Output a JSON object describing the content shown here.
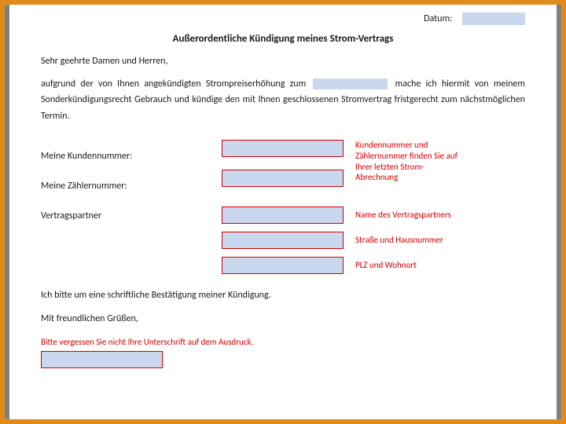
{
  "date_label": "Datum:",
  "title": "Außerordentliche Kündigung meines Strom-Vertrags",
  "salutation": "Sehr geehrte Damen und Herren,",
  "body_pre": "aufgrund der von Ihnen angekündigten Strompreiserhöhung zum ",
  "body_post": " mache ich hiermit von meinem Sonderkündigungsrecht Gebrauch und kündige den mit Ihnen geschlossenen Stromvertrag fristgerecht zum nächstmöglichen Termin.",
  "labels": {
    "kundennummer": "Meine Kundennummer:",
    "zaehlernummer": "Meine Zählernummer:",
    "vertragspartner": "Vertragspartner"
  },
  "hints": {
    "kunden_zaehler": "Kundennummer und Zählernummer finden Sie auf Ihrer letzten Strom-Abrechnung",
    "name_partner": "Name des Vertragspartners",
    "strasse": "Straße und Hausnummer",
    "plz": "PLZ und Wohnort",
    "signature": "Bitte vergessen Sie nicht Ihre Unterschrift auf dem Ausdruck."
  },
  "confirmation": "Ich bitte um eine schriftliche Bestätigung meiner Kündigung.",
  "closing": "Mit freundlichen Grüßen,"
}
